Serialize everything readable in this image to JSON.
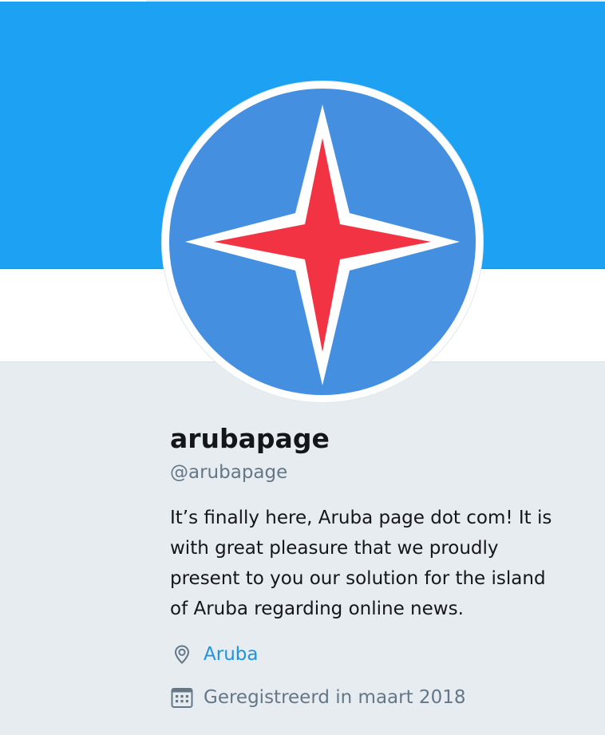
{
  "profile": {
    "name": "arubapage",
    "handle": "@arubapage",
    "bio": "It’s finally here, Aruba page dot com! It is with great pleasure that we proudly present to you our solution for the island of Aruba regarding online news.",
    "location": "Aruba",
    "joined": "Geregistreerd in maart 2018"
  },
  "icons": {
    "location": "location-pin-icon",
    "joined": "calendar-icon"
  },
  "colors": {
    "banner": "#1da1f2",
    "avatar_circle": "#448fdf",
    "star": "#f13343",
    "link": "#1b95e0",
    "secondary_text": "#657786",
    "background": "#e6ecf0"
  }
}
